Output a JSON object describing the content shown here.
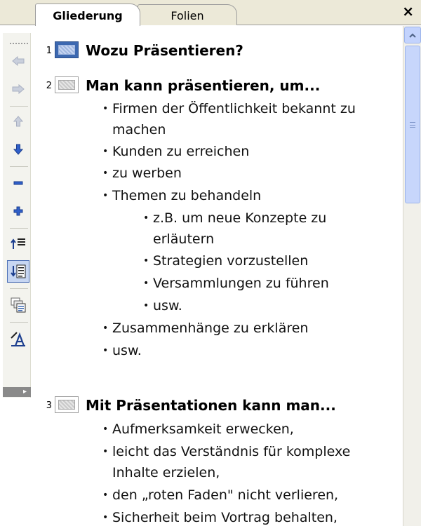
{
  "tabs": {
    "outline": "Gliederung",
    "slides": "Folien",
    "close": "×"
  },
  "toolbar": {
    "icons": [
      "promote-icon",
      "demote-icon",
      "move-up-icon",
      "move-down-icon",
      "collapse-icon",
      "expand-icon",
      "collapse-all-icon",
      "expand-all-icon",
      "summary-slide-icon",
      "show-formatting-icon",
      "toolbar-options-icon"
    ]
  },
  "slides": [
    {
      "num": "1",
      "title": "Wozu Präsentieren?",
      "selected": true
    },
    {
      "num": "2",
      "title": "Man kann präsentieren, um..."
    },
    {
      "num": "3",
      "title": "Mit Präsentationen kann man..."
    }
  ],
  "slide2": {
    "b1a": "Firmen der Öffentlichkeit bekannt zu",
    "b1b": "machen",
    "b2": "Kunden zu erreichen",
    "b3": "zu werben",
    "b4": "Themen zu behandeln",
    "s1a": "z.B. um neue Konzepte zu",
    "s1b": "erläutern",
    "s2": "Strategien vorzustellen",
    "s3": "Versammlungen zu führen",
    "s4": "usw.",
    "b5": "Zusammenhänge zu erklären",
    "b6": "usw."
  },
  "slide3": {
    "b1": "Aufmerksamkeit erwecken,",
    "b2a": "leicht das Verständnis für komplexe",
    "b2b": "Inhalte erzielen,",
    "b3": "den „roten Faden\" nicht verlieren,",
    "b4": "Sicherheit beim Vortrag behalten,"
  },
  "bullet_char": "•"
}
